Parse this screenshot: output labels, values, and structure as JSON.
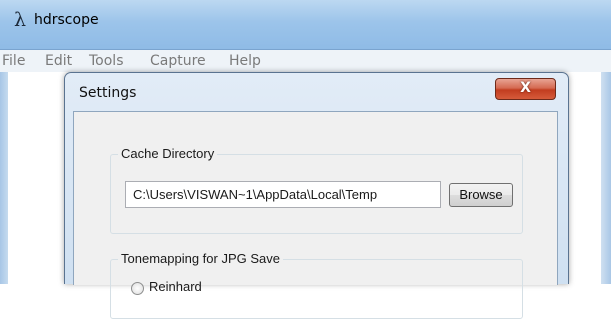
{
  "app": {
    "icon": "lambda-icon",
    "icon_glyph": "λ",
    "title": "hdrscope",
    "menu": [
      "File",
      "Edit",
      "Tools",
      "Capture",
      "Help"
    ]
  },
  "dialog": {
    "title": "Settings",
    "close_glyph": "X",
    "cache": {
      "legend": "Cache Directory",
      "path": "C:\\Users\\VISWAN~1\\AppData\\Local\\Temp",
      "browse_label": "Browse"
    },
    "tonemapping": {
      "legend": "Tonemapping for JPG Save",
      "first_option": "Reinhard"
    }
  }
}
